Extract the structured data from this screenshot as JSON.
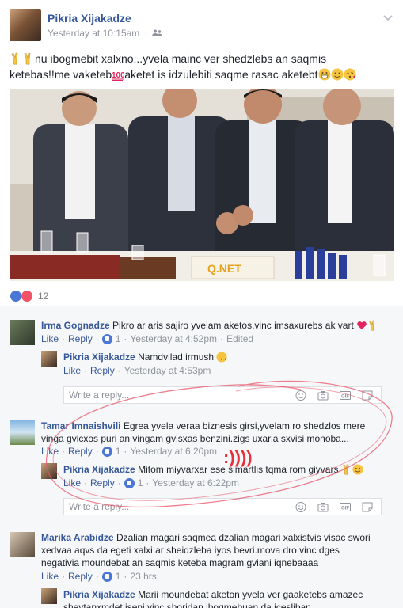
{
  "post": {
    "author": "Pikria Xijakadze",
    "timestamp": "Yesterday at 10:15am",
    "audience_icon": "friends-icon",
    "text_line1": "nu ibogmebit xalxno...yvela mainc ver shedzlebs an saqmis",
    "text_line2a": "ketebas!!me vaketeb",
    "text_line2b": "aketet is idzulebiti saqme rasac aketebt",
    "reaction_count": "12",
    "photo_logo": "Q.NET"
  },
  "comments": [
    {
      "name": "Irma Gognadze",
      "text": "Pikro ar aris sajiro yvelam aketos,vinc imsaxurebs ak vart",
      "like": "Like",
      "reply": "Reply",
      "likes": "1",
      "time": "Yesterday at 4:52pm",
      "edited": "Edited"
    },
    {
      "name": "Pikria Xijakadze",
      "text": "Namdvilad irmush",
      "like": "Like",
      "reply": "Reply",
      "time": "Yesterday at 4:53pm"
    },
    {
      "name": "Tamar Imnaishvili",
      "text_line1": "Egrea yvela veraa biznesis girsi,yvelam ro shedzlos mere",
      "text_line2": "vinga gvicxos puri an vingam gvisxas benzini.zigs uxaria sxvisi monoba...",
      "like": "Like",
      "reply": "Reply",
      "likes": "1",
      "time": "Yesterday at 6:20pm"
    },
    {
      "name": "Pikria Xijakadze",
      "text": "Mitom miyvarxar ese simartlis tqma rom giyvars",
      "like": "Like",
      "reply": "Reply",
      "likes": "1",
      "time": "Yesterday at 6:22pm"
    },
    {
      "name": "Marika Arabidze",
      "text_line1": "Dzalian magari saqmea dzalian magari xalxistvis visac swori",
      "text_line2": "xedvaa aqvs da egeti xalxi ar sheidzleba iyos bevri.mova dro vinc dges",
      "text_line3": "negativia moundebat an saqmis keteba magram gviani iqnebaaaa",
      "like": "Like",
      "reply": "Reply",
      "likes": "1",
      "time": "23 hrs"
    },
    {
      "name": "Pikria Xijakadze",
      "text_line1": "Marii moundebat aketon yvela ver gaaketebs amazec",
      "text_line2": "shevtanxmdet iseni vinc shoridan ibogmebuan da icesliban"
    }
  ],
  "reply_placeholder": "Write a reply...",
  "annotation": ":))))",
  "colors": {
    "link": "#365899",
    "muted": "#90949c",
    "like_blue": "#4a76d6",
    "love_red": "#f25268",
    "annotation_red": "#e8556b"
  }
}
